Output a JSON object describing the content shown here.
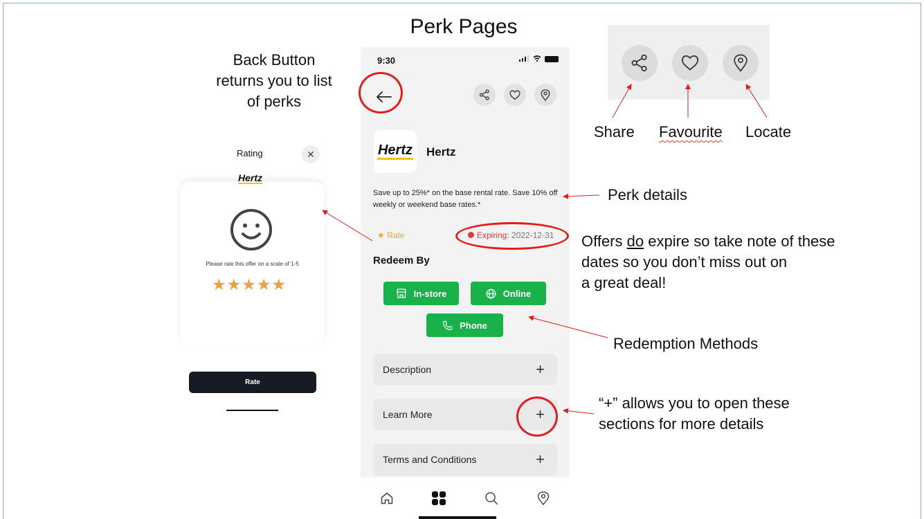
{
  "slide": {
    "title": "Perk Pages"
  },
  "annotations": {
    "back_button": [
      "Back Button",
      "returns you to list",
      "of perks"
    ],
    "share": "Share",
    "favourite": "Favourite",
    "locate": "Locate",
    "perk_details": "Perk details",
    "offers_line1_a": "Offers ",
    "offers_line1_do": "do",
    "offers_line1_b": " expire so take note of these",
    "offers_line2": "dates so you don’t miss out on",
    "offers_line3": "a great deal!",
    "redemption_methods": "Redemption Methods",
    "plus_line1": "“+” allows you to open these",
    "plus_line2": "sections for more details"
  },
  "phone": {
    "status_time": "9:30",
    "brand_logo": "Hertz",
    "brand_name": "Hertz",
    "description": "Save up to 25%* on the base rental rate.  Save 10% off weekly or weekend base rates.*",
    "rate_label": "Rate",
    "expiring_label": "Expiring:",
    "expiring_date": "2022-12-31",
    "redeem_title": "Redeem By",
    "redeem_buttons": {
      "in_store": "In-store",
      "online": "Online",
      "phone": "Phone"
    },
    "sections": {
      "description": "Description",
      "learn_more": "Learn More",
      "terms": "Terms and Conditions"
    },
    "icons": {
      "back": "back-arrow-icon",
      "share": "share-icon",
      "favourite": "heart-icon",
      "locate": "location-pin-icon",
      "tabs": [
        "home-icon",
        "grid-icon",
        "search-icon",
        "location-pin-icon"
      ]
    }
  },
  "rating_modal": {
    "title": "Rating",
    "logo": "Hertz",
    "prompt": "Please rate this offer on a scale of 1-5",
    "stars": "★★★★★",
    "rate_button": "Rate"
  },
  "colors": {
    "green": "#19b24a",
    "red_annotation": "#e31c1c",
    "star": "#e8a33b",
    "hertz_yellow": "#f5c400"
  }
}
